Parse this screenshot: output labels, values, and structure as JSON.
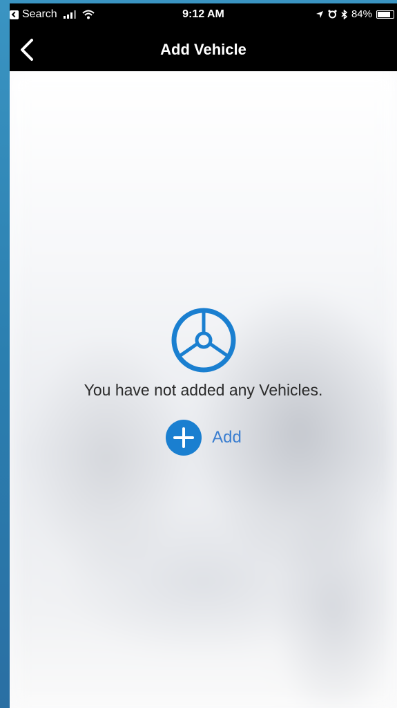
{
  "status_bar": {
    "back_app_label": "Search",
    "time": "9:12 AM",
    "battery_percent": "84%",
    "battery_level": 0.84,
    "icons": [
      "back-app-icon",
      "signal-icon",
      "wifi-icon",
      "location-icon",
      "alarm-icon",
      "bluetooth-icon",
      "battery-icon"
    ]
  },
  "nav_bar": {
    "title": "Add Vehicle",
    "back_icon": "chevron-left-icon"
  },
  "empty_state": {
    "icon": "steering-wheel-icon",
    "message": "You have not added any Vehicles.",
    "add_label": "Add",
    "add_icon": "plus-circle-icon"
  },
  "colors": {
    "accent": "#1a7fd0",
    "add_text": "#3b7ed0",
    "bar_background": "#000000"
  }
}
